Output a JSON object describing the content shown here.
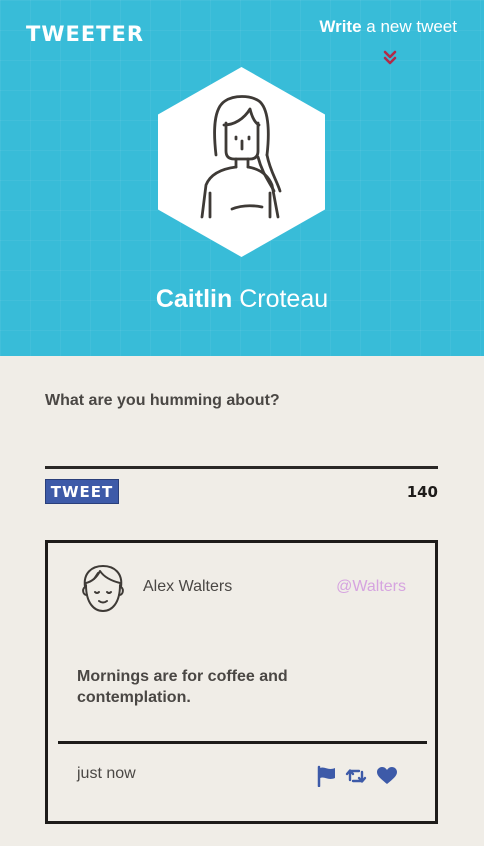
{
  "header": {
    "logo": "TWEETER",
    "write_bold": "Write",
    "write_rest": " a new tweet",
    "user_first": "Caitlin",
    "user_last": " Croteau"
  },
  "compose": {
    "prompt": "What are you humming about?",
    "input_value": "",
    "button_label": "TWEET",
    "char_count": "140"
  },
  "tweet": {
    "author_name": "Alex Walters",
    "author_handle": "@Walters",
    "body": "Mornings are for coffee and contemplation.",
    "timestamp": "just now",
    "actions": [
      "flag-icon",
      "retweet-icon",
      "heart-icon"
    ]
  },
  "colors": {
    "header_bg": "#38bcd8",
    "page_bg": "#f0ede7",
    "accent_blue": "#3d5aa8",
    "chevron_red": "#b22a48",
    "handle_purple": "#d6a4e0"
  }
}
